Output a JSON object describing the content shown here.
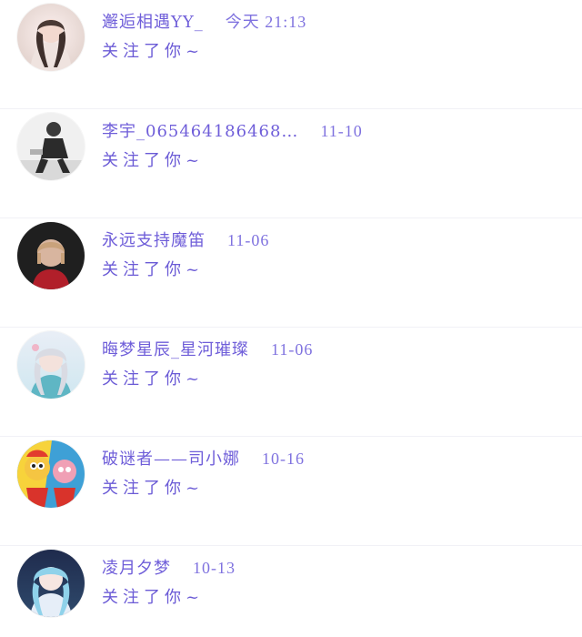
{
  "notifications": [
    {
      "name": "邂逅相遇YY_",
      "time": "今天 21:13",
      "message": "关注了你~",
      "avatar": "avatar-girl-portrait"
    },
    {
      "name": "李宇_065464186468…",
      "time": "11-10",
      "message": "关注了你~",
      "avatar": "avatar-man-black-white"
    },
    {
      "name": "永远支持魔笛",
      "time": "11-06",
      "message": "关注了你~",
      "avatar": "avatar-footballer"
    },
    {
      "name": "晦梦星辰_星河璀璨",
      "time": "11-06",
      "message": "关注了你~",
      "avatar": "avatar-anime-girl"
    },
    {
      "name": "破谜者——司小娜",
      "time": "10-16",
      "message": "关注了你~",
      "avatar": "avatar-cartoon-duo"
    },
    {
      "name": "凌月夕梦",
      "time": "10-13",
      "message": "关注了你~",
      "avatar": "avatar-blue-hair-anime"
    }
  ]
}
